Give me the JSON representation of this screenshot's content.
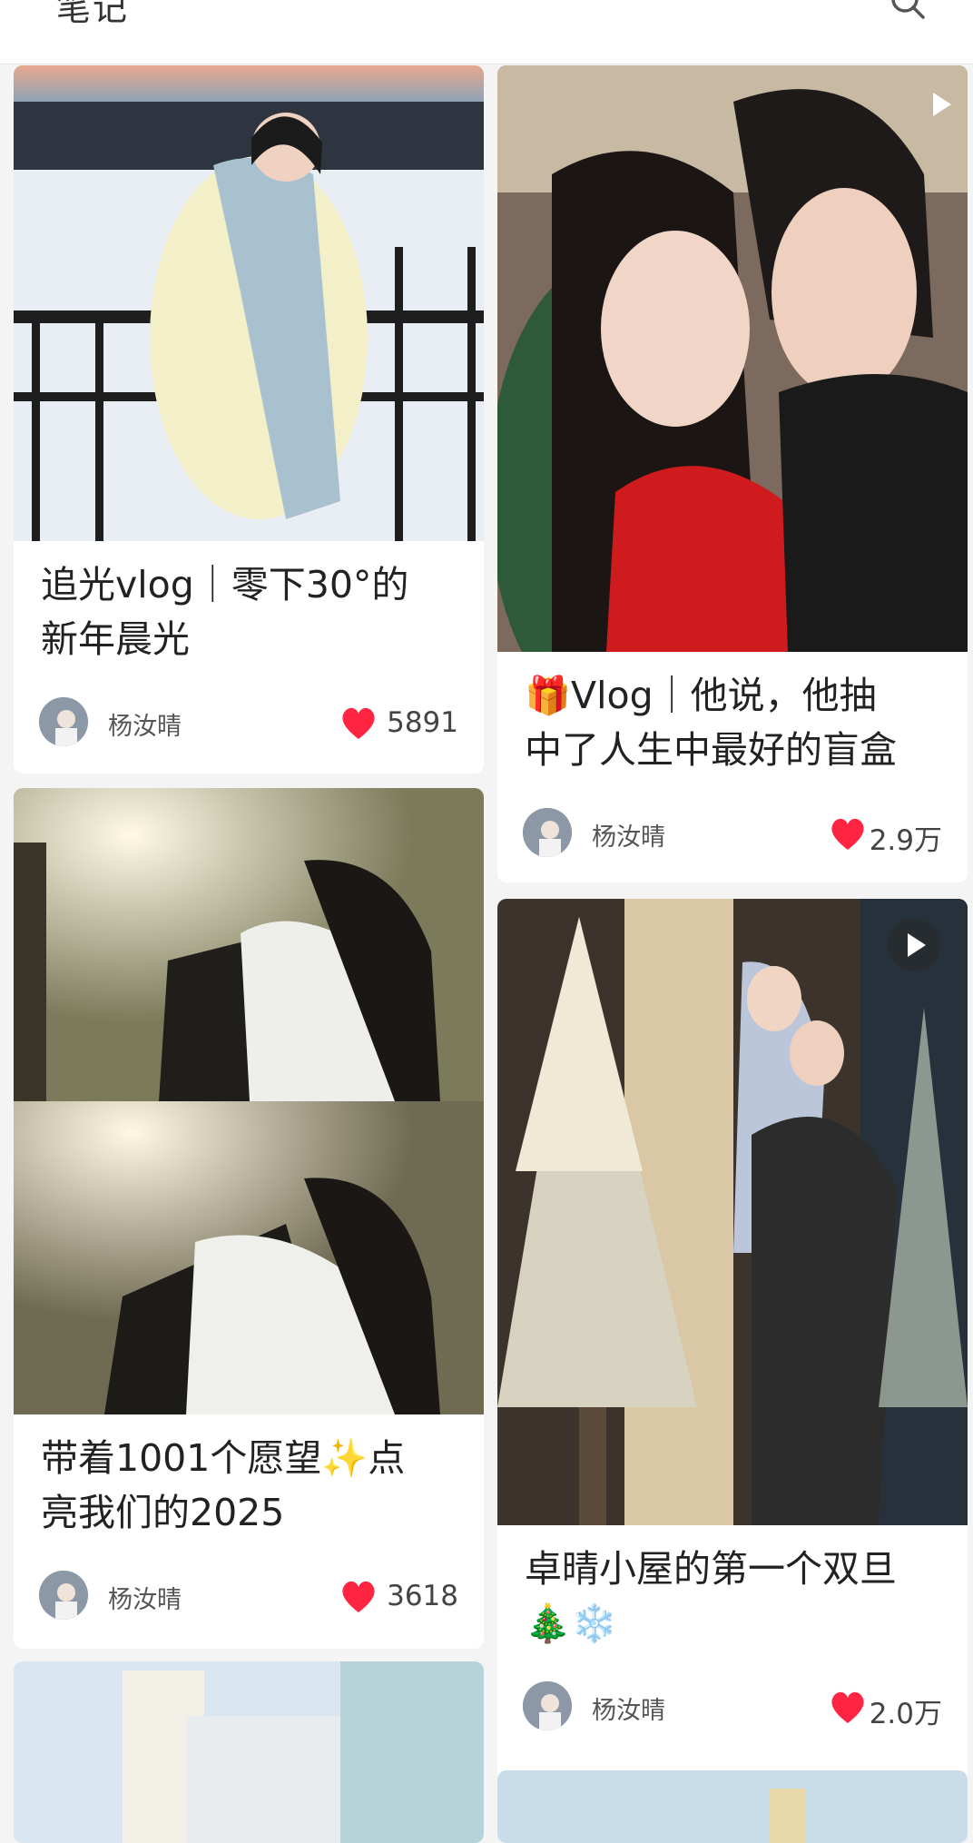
{
  "header": {
    "title": "笔记",
    "search_icon": "search-icon"
  },
  "colors": {
    "like": "#ff2442",
    "background": "#f4f4f4"
  },
  "posts": [
    {
      "title": "追光vlog｜零下30°的新年晨光",
      "title_lines": [
        "追光vlog｜零下30°的",
        "新年晨光"
      ],
      "author": "杨汝晴",
      "likes": "5891",
      "type": "image"
    },
    {
      "title": "🎁Vlog｜他说，他抽中了人生中最好的盲盒",
      "title_lines": [
        "🎁Vlog｜他说，他抽",
        "中了人生中最好的盲盒"
      ],
      "author": "杨汝晴",
      "likes": "2.9万",
      "type": "video"
    },
    {
      "title": "带着1001个愿望✨点亮我们的2025",
      "title_lines": [
        "带着1001个愿望✨点",
        "亮我们的2025"
      ],
      "author": "杨汝晴",
      "likes": "3618",
      "type": "image"
    },
    {
      "title": "卓晴小屋的第一个双旦🎄❄️",
      "title_lines": [
        "卓晴小屋的第一个双旦",
        "🎄❄️"
      ],
      "author": "杨汝晴",
      "likes": "2.0万",
      "type": "video"
    }
  ]
}
